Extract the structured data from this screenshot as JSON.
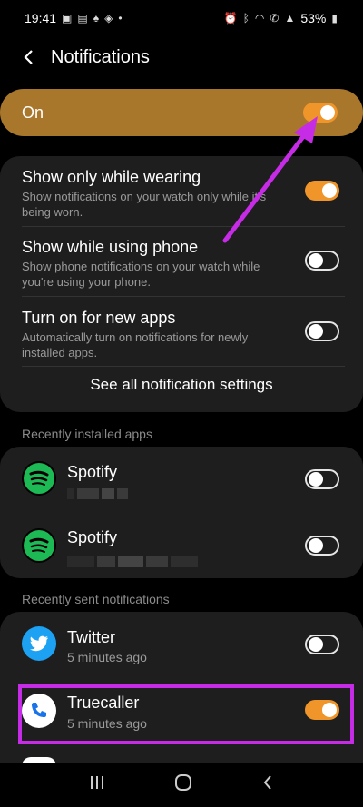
{
  "status_bar": {
    "time": "19:41",
    "battery": "53%",
    "left_icons": [
      "gallery-icon",
      "photo-icon",
      "twitter-icon",
      "shield-icon",
      "dot-icon"
    ],
    "right_icons": [
      "alarm-icon",
      "bluetooth-icon",
      "wifi-icon",
      "call-icon",
      "signal-icon",
      "battery-icon"
    ]
  },
  "header": {
    "title": "Notifications"
  },
  "master": {
    "label": "On",
    "state": "on"
  },
  "settings": [
    {
      "title": "Show only while wearing",
      "desc": "Show notifications on your watch only while it's being worn.",
      "state": "on"
    },
    {
      "title": "Show while using phone",
      "desc": "Show phone notifications on your watch while you're using your phone.",
      "state": "off"
    },
    {
      "title": "Turn on for new apps",
      "desc": "Automatically turn on notifications for newly installed apps.",
      "state": "off"
    }
  ],
  "see_all_label": "See all notification settings",
  "recently_installed": {
    "label": "Recently installed apps",
    "apps": [
      {
        "name": "Spotify",
        "state": "off"
      },
      {
        "name": "Spotify",
        "state": "off"
      }
    ]
  },
  "recently_sent": {
    "label": "Recently sent notifications",
    "apps": [
      {
        "name": "Twitter",
        "sub": "5 minutes ago",
        "state": "off"
      },
      {
        "name": "Truecaller",
        "sub": "5 minutes ago",
        "state": "on"
      }
    ]
  },
  "colors": {
    "accent": "#f0952a",
    "master_bg": "#a8772b",
    "annotation": "#c62be6",
    "twitter": "#1da1f2",
    "spotify": "#1db954",
    "truecaller": "#1a73e8"
  }
}
